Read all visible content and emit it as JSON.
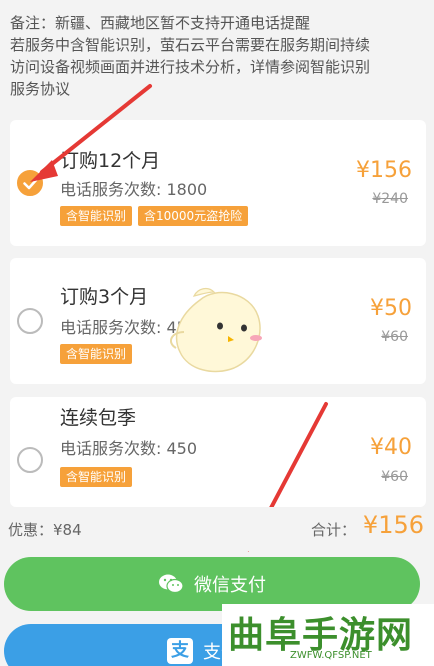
{
  "notice": {
    "line1": "备注：新疆、西藏地区暂不支持开通电话提醒",
    "line2": "若服务中含智能识别，萤石云平台需要在服务期间持续",
    "line3": "访问设备视频画面并进行技术分析，详情参阅智能识别",
    "line4": "服务协议"
  },
  "plans": [
    {
      "title": "订购12个月",
      "calls": "电话服务次数: 1800",
      "tags": [
        "含智能识别",
        "含10000元盗抢险"
      ],
      "price": "¥156",
      "old_price": "¥240",
      "selected": true
    },
    {
      "title": "订购3个月",
      "calls": "电话服务次数: 450",
      "tags": [
        "含智能识别"
      ],
      "price": "¥50",
      "old_price": "¥60",
      "selected": false
    },
    {
      "title": "连续包季",
      "calls": "电话服务次数: 450",
      "tags": [
        "含智能识别"
      ],
      "price": "¥40",
      "old_price": "¥60",
      "selected": false
    }
  ],
  "summary": {
    "discount": "优惠：¥84",
    "total_label": "合计：",
    "total_price": "¥156"
  },
  "payment": {
    "wechat_label": "微信支付",
    "alipay_label": "支付宝"
  },
  "watermark": {
    "title": "曲阜手游网",
    "url": "ZWFW.QFSP.NET"
  },
  "colors": {
    "accent": "#f6a13a",
    "wechat": "#5fc35f",
    "alipay": "#3b9fe6",
    "arrow": "#e53935"
  }
}
